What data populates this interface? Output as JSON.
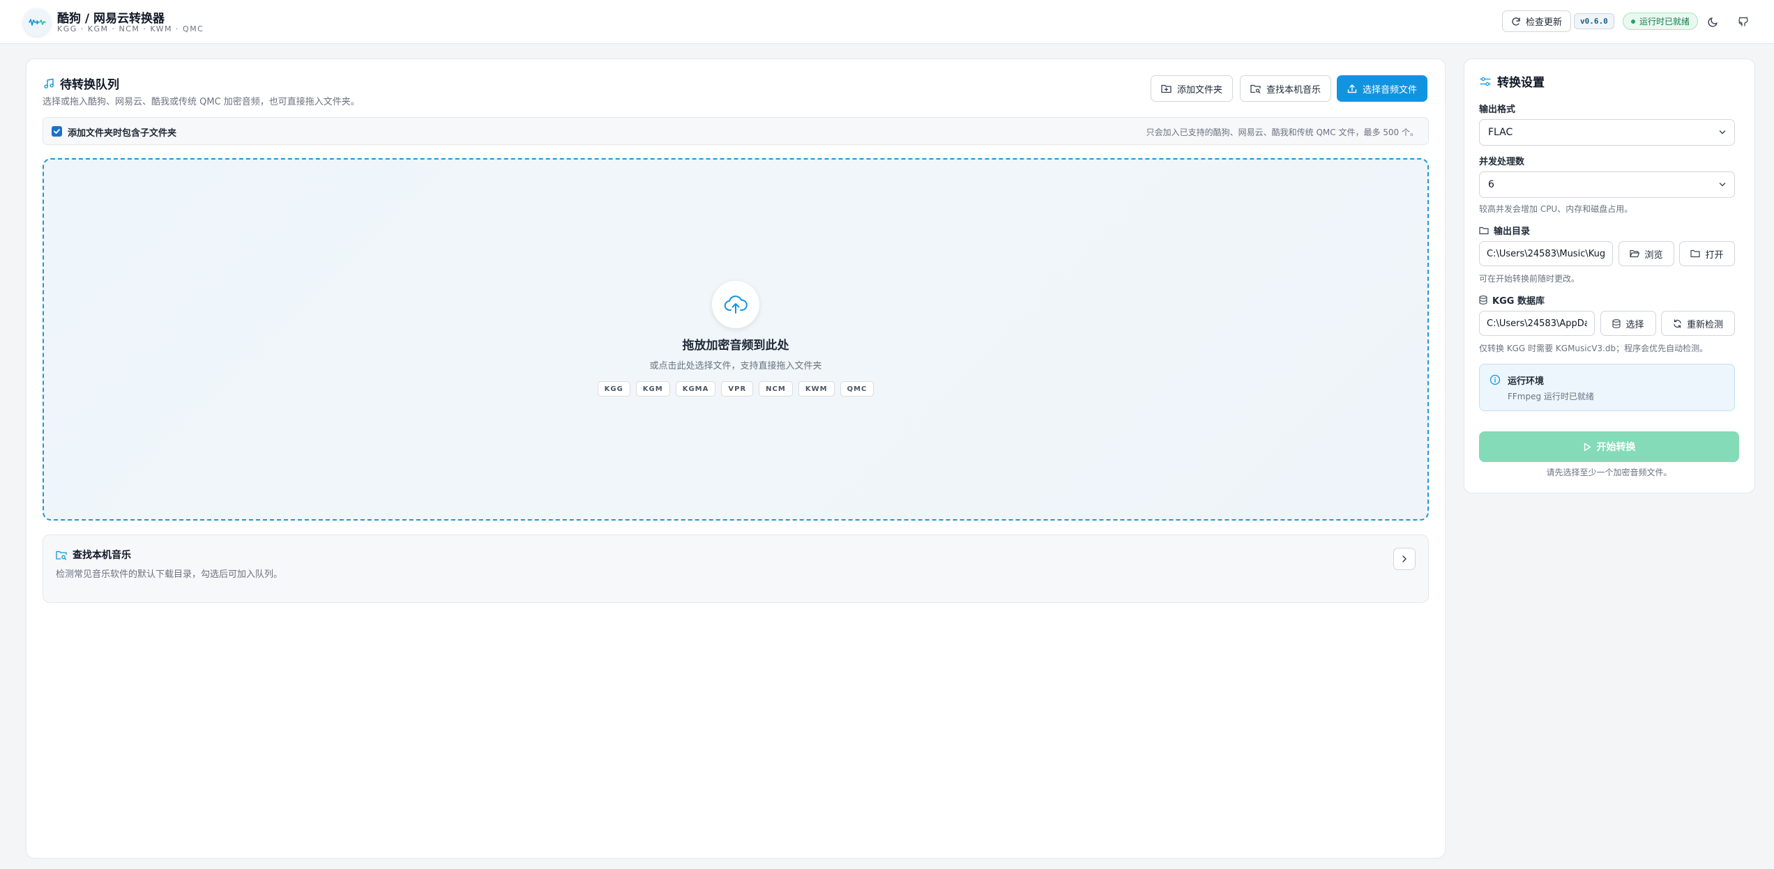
{
  "header": {
    "title": "酷狗 / 网易云转换器",
    "subtitle": "KGG · KGM · NCM · KWM · QMC",
    "check_update": "检查更新",
    "version": "v0.6.0",
    "status": "运行时已就绪",
    "theme_icon": "moon-icon",
    "github_icon": "github-icon"
  },
  "queue": {
    "title": "待转换队列",
    "description": "选择或拖入酷狗、网易云、酷我或传统 QMC 加密音频，也可直接拖入文件夹。",
    "add_folder": "添加文件夹",
    "find_local": "查找本机音乐",
    "choose_files": "选择音频文件",
    "include_subfolders": "添加文件夹时包含子文件夹",
    "include_subfolders_checked": true,
    "limit_note": "只会加入已支持的酷狗、网易云、酷我和传统 QMC 文件，最多 500 个。"
  },
  "dropzone": {
    "title": "拖放加密音频到此处",
    "subtitle": "或点击此处选择文件，支持直接拖入文件夹",
    "formats": [
      "KGG",
      "KGM",
      "KGMA",
      "VPR",
      "NCM",
      "KWM",
      "QMC"
    ]
  },
  "finder": {
    "title": "查找本机音乐",
    "description": "检测常见音乐软件的默认下载目录，勾选后可加入队列。"
  },
  "settings": {
    "title": "转换设置",
    "format_label": "输出格式",
    "format_value": "FLAC",
    "concurrency_label": "并发处理数",
    "concurrency_value": "6",
    "concurrency_hint": "较高并发会增加 CPU、内存和磁盘占用。",
    "output_dir_label": "输出目录",
    "output_dir_value": "C:\\Users\\24583\\Music\\Kug",
    "browse": "浏览",
    "open": "打开",
    "output_hint": "可在开始转换前随时更改。",
    "kgg_db_label": "KGG 数据库",
    "kgg_db_value": "C:\\Users\\24583\\AppDa",
    "choose": "选择",
    "recheck": "重新检测",
    "kgg_hint": "仅转换 KGG 时需要 KGMusicV3.db；程序会优先自动检测。",
    "env_title": "运行环境",
    "env_desc": "FFmpeg 运行时已就绪",
    "start": "开始转换",
    "start_hint": "请先选择至少一个加密音频文件。"
  },
  "colors": {
    "accent": "#1194e0",
    "success": "#22a55e",
    "start_disabled": "#84dbb8"
  }
}
